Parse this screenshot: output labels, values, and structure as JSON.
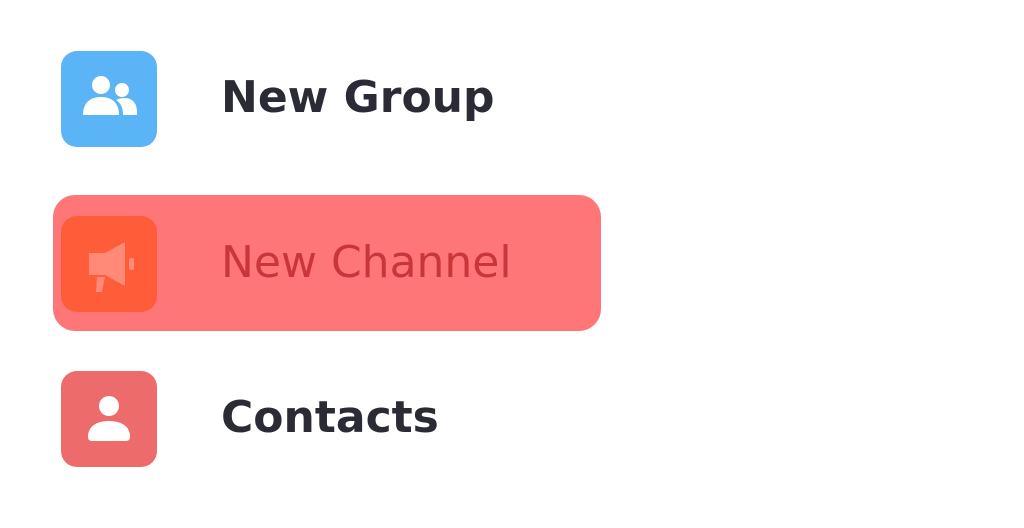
{
  "menu": {
    "items": [
      {
        "label": "New Group",
        "icon": "group-icon",
        "icon_bg": "#5ab4f5",
        "highlighted": false
      },
      {
        "label": "New Channel",
        "icon": "megaphone-icon",
        "icon_bg": "#ff5d3a",
        "highlighted": true
      },
      {
        "label": "Contacts",
        "icon": "person-icon",
        "icon_bg": "#ee6b6b",
        "highlighted": false
      }
    ]
  },
  "colors": {
    "highlight": "#ff7678",
    "label_text": "#2b2b36",
    "highlighted_label_text": "#c93638"
  }
}
